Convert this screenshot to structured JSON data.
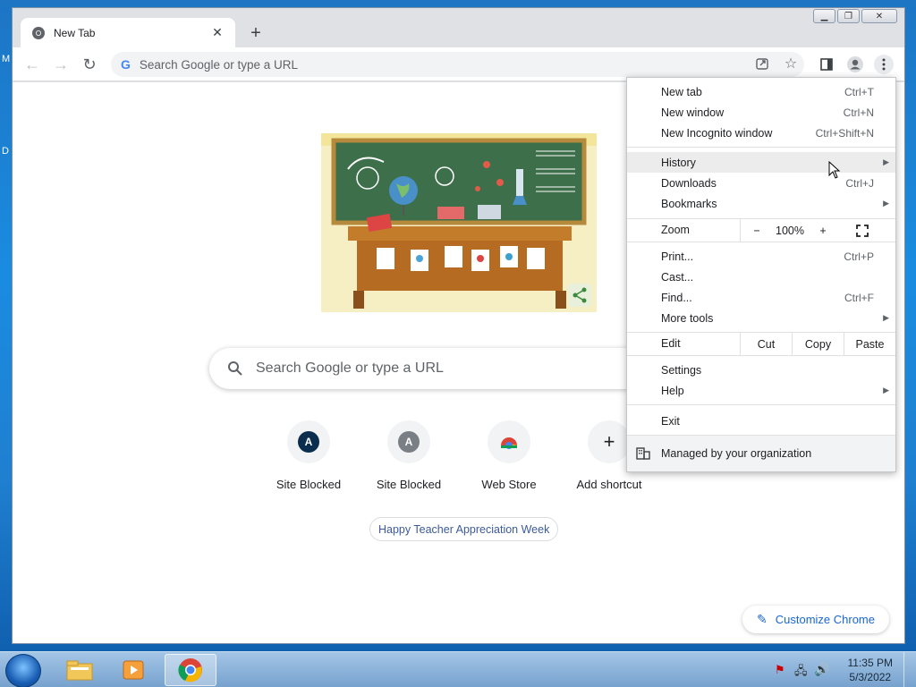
{
  "desktop": {
    "letter_m": "M",
    "letter_d": "D"
  },
  "window": {
    "tab_title": "New Tab"
  },
  "toolbar": {
    "omnibox_placeholder": "Search Google or type a URL",
    "omnibox_g": "G"
  },
  "ntp": {
    "search_placeholder": "Search Google or type a URL",
    "shortcuts": [
      {
        "label": "Site Blocked",
        "letter": "A",
        "color": "#0b2e4f"
      },
      {
        "label": "Site Blocked",
        "letter": "A",
        "color": "#7a7f86"
      },
      {
        "label": "Web Store",
        "letter": "",
        "color": ""
      },
      {
        "label": "Add shortcut",
        "letter": "+",
        "color": ""
      }
    ],
    "promo": "Happy Teacher Appreciation Week",
    "customize": "Customize Chrome"
  },
  "menu": {
    "new_tab": {
      "label": "New tab",
      "shortcut": "Ctrl+T"
    },
    "new_window": {
      "label": "New window",
      "shortcut": "Ctrl+N"
    },
    "incognito": {
      "label": "New Incognito window",
      "shortcut": "Ctrl+Shift+N"
    },
    "history": {
      "label": "History"
    },
    "downloads": {
      "label": "Downloads",
      "shortcut": "Ctrl+J"
    },
    "bookmarks": {
      "label": "Bookmarks"
    },
    "zoom": {
      "label": "Zoom",
      "minus": "−",
      "value": "100%",
      "plus": "+"
    },
    "print": {
      "label": "Print...",
      "shortcut": "Ctrl+P"
    },
    "cast": {
      "label": "Cast..."
    },
    "find": {
      "label": "Find...",
      "shortcut": "Ctrl+F"
    },
    "more_tools": {
      "label": "More tools"
    },
    "edit": {
      "label": "Edit",
      "cut": "Cut",
      "copy": "Copy",
      "paste": "Paste"
    },
    "settings": {
      "label": "Settings"
    },
    "help": {
      "label": "Help"
    },
    "exit": {
      "label": "Exit"
    },
    "managed": {
      "label": "Managed by your organization"
    }
  },
  "taskbar": {
    "time": "11:35 PM",
    "date": "5/3/2022"
  }
}
